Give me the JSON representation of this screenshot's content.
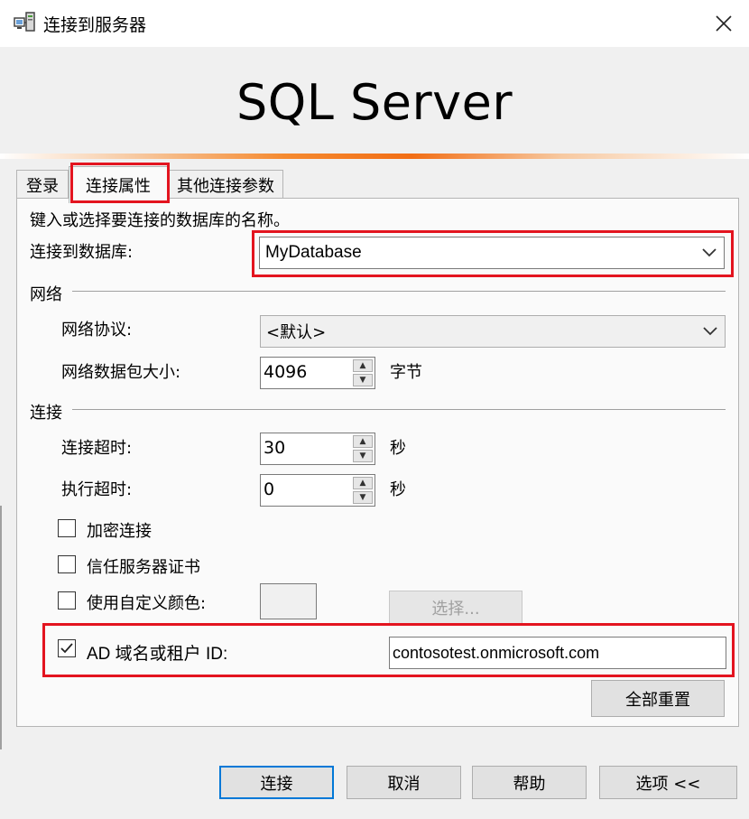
{
  "window": {
    "title": "连接到服务器"
  },
  "banner": {
    "product": "SQL Server"
  },
  "tabs": [
    {
      "label": "登录"
    },
    {
      "label": "连接属性"
    },
    {
      "label": "其他连接参数"
    }
  ],
  "panel": {
    "instruction": "键入或选择要连接的数据库的名称。",
    "database_label": "连接到数据库:",
    "database_value": "MyDatabase",
    "network": {
      "heading": "网络",
      "protocol_label": "网络协议:",
      "protocol_value": "<默认>",
      "packet_label": "网络数据包大小:",
      "packet_value": "4096",
      "packet_unit": "字节"
    },
    "connection": {
      "heading": "连接",
      "timeout_label": "连接超时:",
      "timeout_value": "30",
      "timeout_unit": "秒",
      "exec_label": "执行超时:",
      "exec_value": "0",
      "exec_unit": "秒"
    },
    "checkboxes": {
      "encrypt": {
        "label": "加密连接",
        "checked": false
      },
      "trust": {
        "label": "信任服务器证书",
        "checked": false
      },
      "custom_color": {
        "label": "使用自定义颜色:",
        "checked": false
      },
      "ad_domain": {
        "label": "AD 域名或租户 ID:",
        "checked": true
      }
    },
    "select_button": "选择...",
    "ad_domain_value": "contosotest.onmicrosoft.com",
    "reset_button": "全部重置"
  },
  "footer": {
    "connect": "连接",
    "cancel": "取消",
    "help": "帮助",
    "options": "选项 <<"
  },
  "colors": {
    "highlight_red": "#e3141f",
    "accent_orange": "#f26e15",
    "default_button_blue": "#0078d7"
  }
}
